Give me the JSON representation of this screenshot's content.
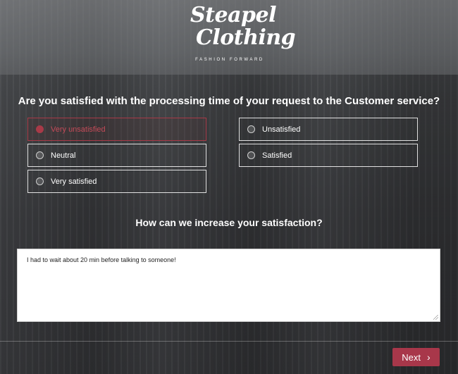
{
  "brand": {
    "name_line1": "Steapel",
    "name_line2": "Clothing",
    "tagline": "FASHION FORWARD"
  },
  "question1": {
    "text": "Are you satisfied with the processing time of your request to the Customer service?",
    "options": [
      {
        "label": "Very unsatisfied",
        "selected": true
      },
      {
        "label": "Unsatisfied",
        "selected": false
      },
      {
        "label": "Neutral",
        "selected": false
      },
      {
        "label": "Satisfied",
        "selected": false
      },
      {
        "label": "Very satisfied",
        "selected": false
      }
    ]
  },
  "question2": {
    "text": "How can we increase your satisfaction?",
    "answer": "I had to wait about 20 min before talking to someone!"
  },
  "footer": {
    "next_label": "Next",
    "next_icon": "chevron-right-icon"
  },
  "colors": {
    "accent": "#a8374a",
    "text": "#ffffff"
  }
}
